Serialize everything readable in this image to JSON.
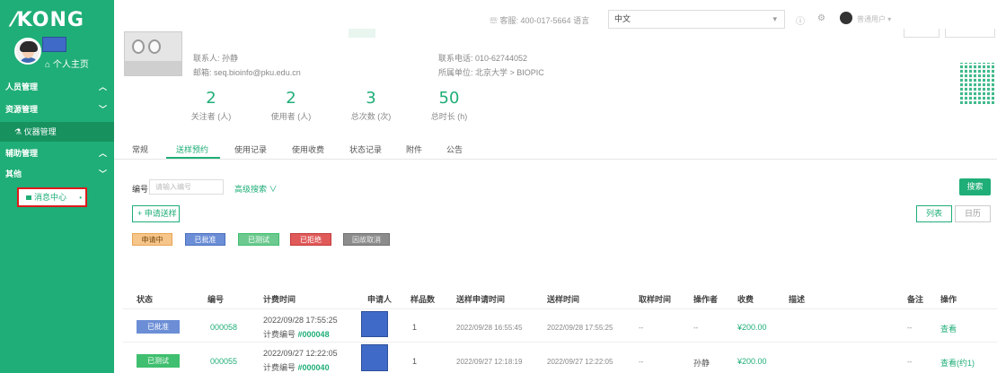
{
  "app": {
    "logo": "KONG"
  },
  "sidebar": {
    "home_label": "个人主页",
    "items": [
      {
        "label": "人员管理",
        "chev": "^"
      },
      {
        "label": "资源管理",
        "chev": "v"
      },
      {
        "label": "仪器管理"
      },
      {
        "label": "辅助管理",
        "chev": "^"
      },
      {
        "label": "其他",
        "chev": "v"
      },
      {
        "label": "消息中心"
      }
    ]
  },
  "topbar": {
    "service": "客服: 400-017-5664  语言",
    "language": "中文",
    "user": "普通用户"
  },
  "instrument": {
    "contact": "联系人: 孙静",
    "email": "邮箱: seq.bioinfo@pku.edu.cn",
    "phone": "联系电话: 010-62744052",
    "unit": "所属单位: 北京大学 > BIOPIC"
  },
  "stats": [
    {
      "value": "2",
      "label": "关注者 (人)"
    },
    {
      "value": "2",
      "label": "使用者 (人)"
    },
    {
      "value": "3",
      "label": "总次数 (次)"
    },
    {
      "value": "50",
      "label": "总时长 (h)"
    }
  ],
  "tabs": [
    "常规",
    "送样预约",
    "使用记录",
    "使用收费",
    "状态记录",
    "附件",
    "公告"
  ],
  "filter": {
    "label": "编号",
    "placeholder": "请输入编号",
    "advanced": "高级搜索 ∨",
    "search": "搜索",
    "apply": "+ 申请送样",
    "view_list": "列表",
    "view_calendar": "日历"
  },
  "legend": [
    {
      "label": "申请中",
      "color": "#f5c58a"
    },
    {
      "label": "已批准",
      "color": "#6b8ed6"
    },
    {
      "label": "已测试",
      "color": "#6cc98f"
    },
    {
      "label": "已拒绝",
      "color": "#e05a5a"
    },
    {
      "label": "因故取消",
      "color": "#8c8c8c"
    }
  ],
  "table": {
    "headers": [
      "状态",
      "编号",
      "计费时间",
      "申请人",
      "样品数",
      "送样申请时间",
      "送样时间",
      "取样时间",
      "操作者",
      "收费",
      "描述",
      "备注",
      "操作"
    ],
    "rows": [
      {
        "status": "已批准",
        "status_color": "#6b8ed6",
        "id": "000058",
        "bill_time": "2022/09/28 17:55:25",
        "bill_no_label": "计费编号",
        "bill_no": "#000048",
        "samples": "1",
        "apply_time": "2022/09/28 16:55:45",
        "send_time": "2022/09/28 17:55:25",
        "take_time": "--",
        "operator": "--",
        "fee": "¥200.00",
        "remark": "--",
        "action": "查看"
      },
      {
        "status": "已测试",
        "status_color": "#3fbf6f",
        "id": "000055",
        "bill_time": "2022/09/27 12:22:05",
        "bill_no_label": "计费编号",
        "bill_no": "#000040",
        "samples": "1",
        "apply_time": "2022/09/27 12:18:19",
        "send_time": "2022/09/27 12:22:05",
        "take_time": "--",
        "operator": "孙静",
        "fee": "¥200.00",
        "remark": "--",
        "action": "查看(约1)"
      }
    ]
  }
}
